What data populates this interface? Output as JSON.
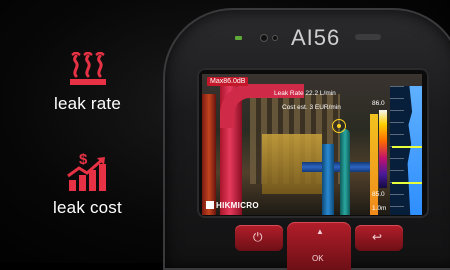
{
  "features": [
    {
      "icon": "heat-waves-icon",
      "label": "leak rate"
    },
    {
      "icon": "dollar-growth-chart-icon",
      "label": "leak cost"
    }
  ],
  "device": {
    "model": "AI56",
    "overlay": {
      "max_temp": "Max86.0dB",
      "leak_rate": "Leak Rate 22.2 L/min",
      "cost_est": "Cost est.   3 EUR/min",
      "scale_top": "86.0",
      "scale_bottom": "85.0",
      "distance": "1.0m"
    },
    "brand": "HIKMICRO",
    "buttons": {
      "ok": "OK"
    }
  },
  "colors": {
    "accent": "#e63244",
    "background": "#000000"
  }
}
